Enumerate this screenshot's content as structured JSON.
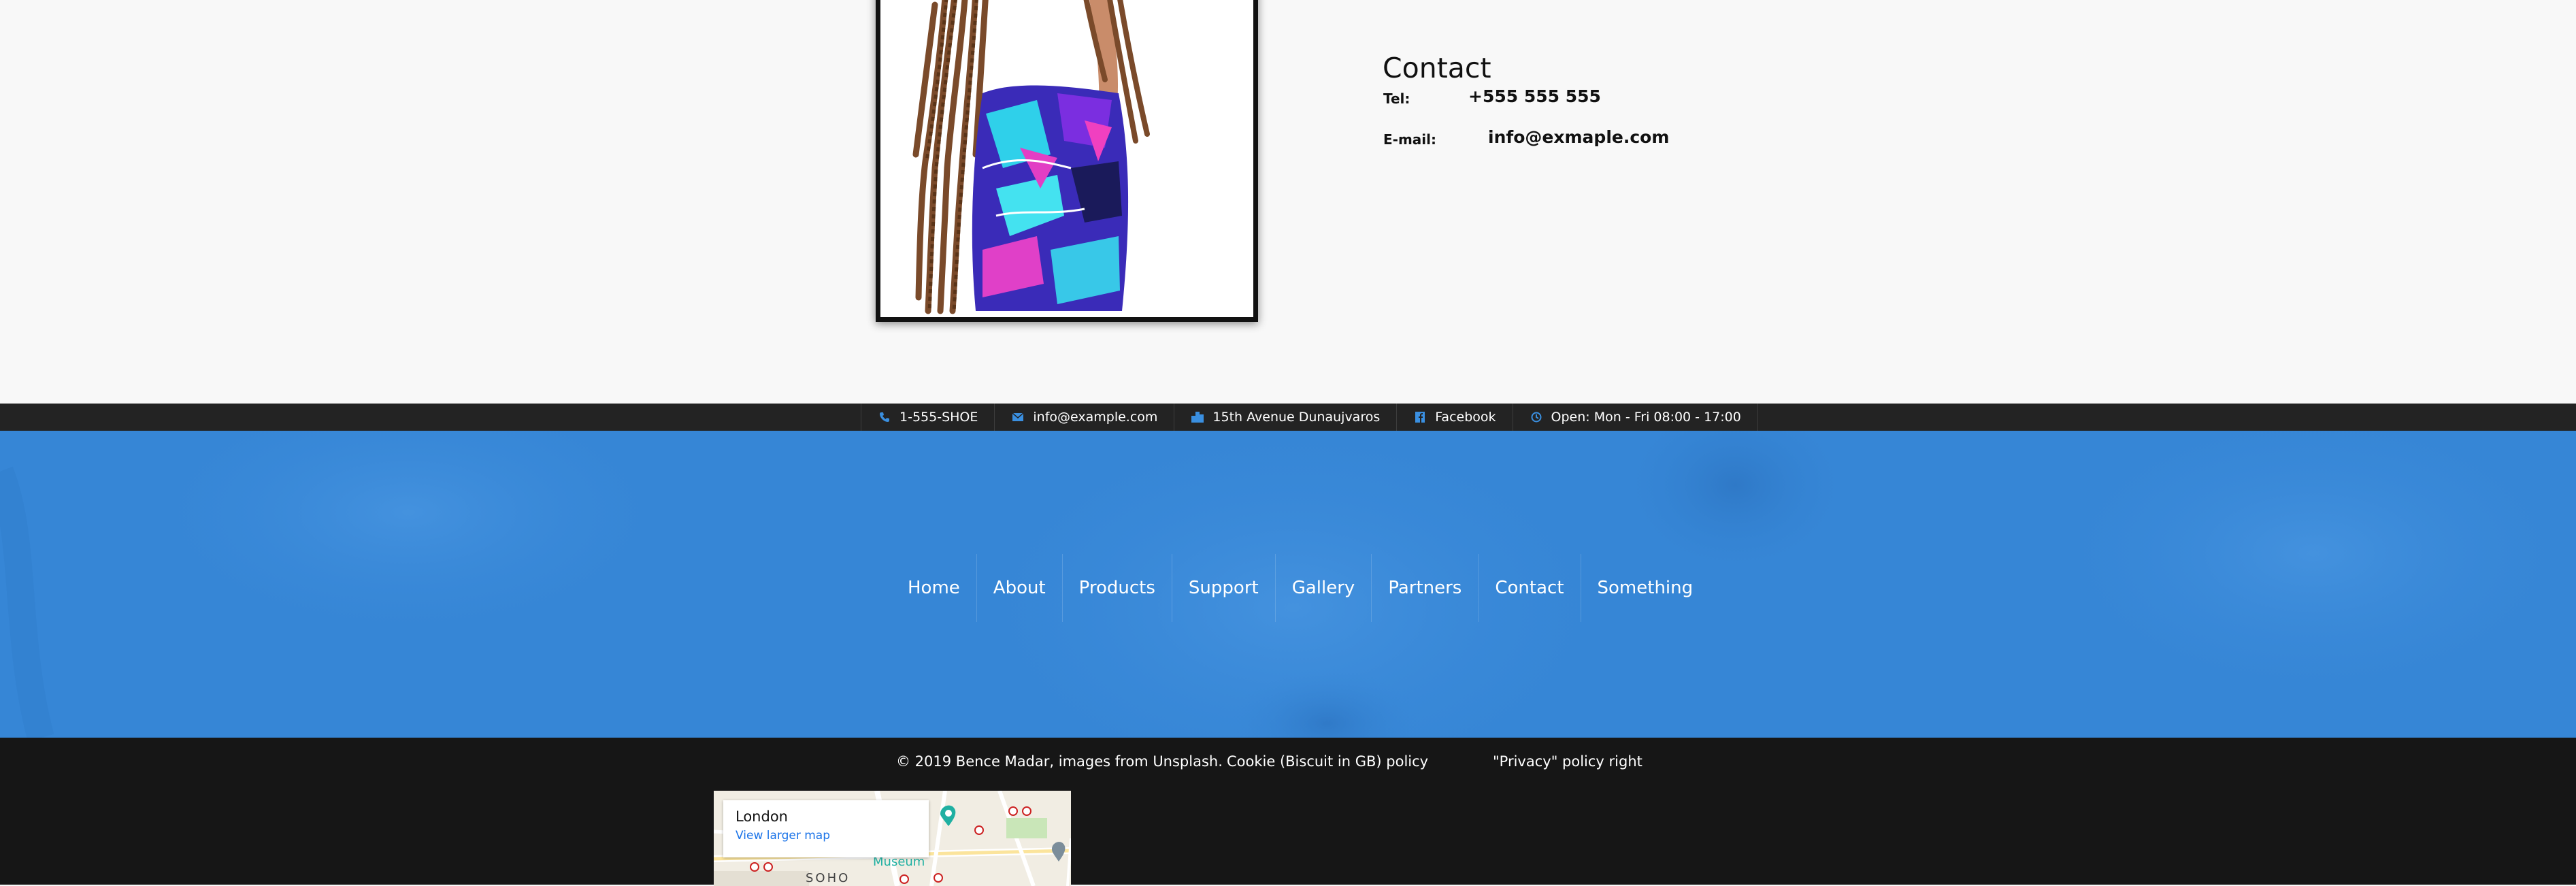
{
  "contact": {
    "title": "Contact",
    "tel_label": "Tel:",
    "tel_value": "+555 555 555",
    "email_label": "E-mail:",
    "email_value": "info@exmaple.com"
  },
  "info_bar": {
    "phone": "1-555-SHOE",
    "email": "info@example.com",
    "address": "15th Avenue Dunaujvaros",
    "social": "Facebook",
    "hours": "Open: Mon - Fri 08:00 - 17:00",
    "icon_color": "#3a8fe0"
  },
  "nav": {
    "items": [
      "Home",
      "About",
      "Products",
      "Support",
      "Gallery",
      "Partners",
      "Contact",
      "Something"
    ]
  },
  "footer": {
    "copyright": "© 2019 Bence Madar, images from Unsplash.",
    "cookie": "Cookie (Biscuit in GB) policy",
    "privacy": "\"Privacy\" policy right"
  },
  "map": {
    "place": "London",
    "link": "View larger map",
    "label_museum": "Museum",
    "label_soho": "SOHO"
  },
  "colors": {
    "accent_blue": "#3686d6",
    "dark_bar": "#232323",
    "footer_bg": "#161616"
  }
}
